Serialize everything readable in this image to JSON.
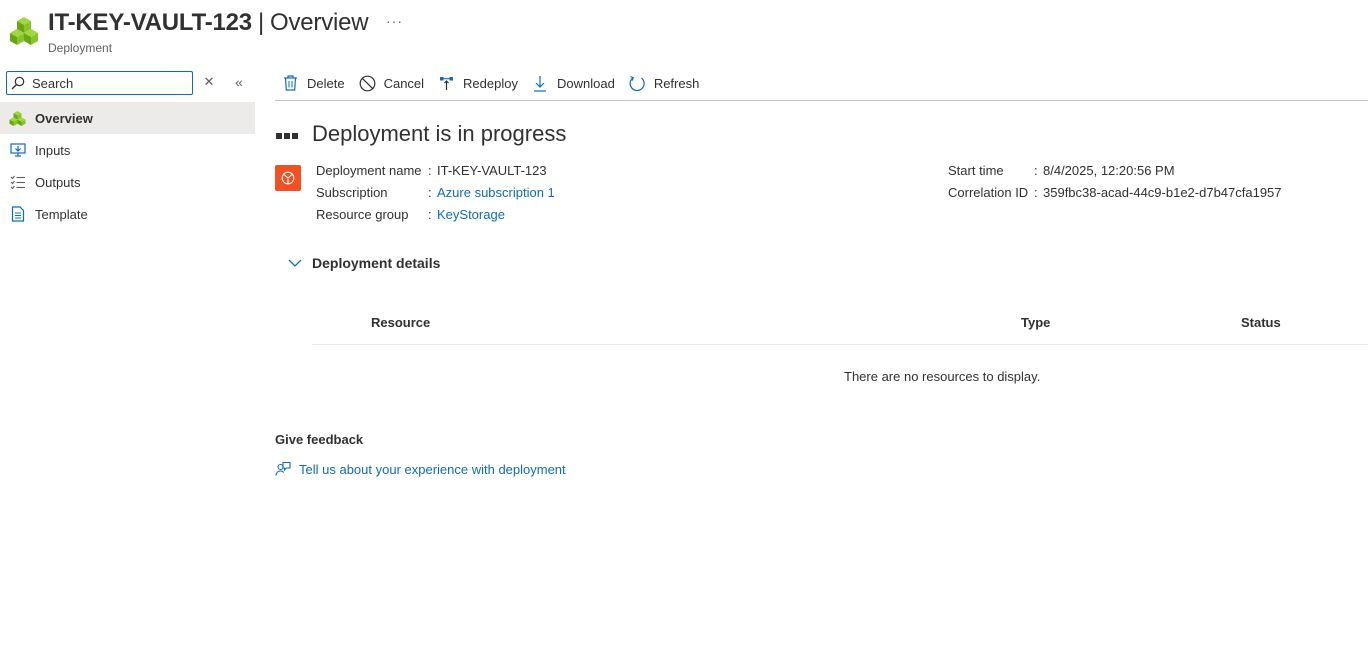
{
  "header": {
    "resource_name": "IT-KEY-VAULT-123",
    "separator": "|",
    "page_name": "Overview",
    "more": "···",
    "subtitle": "Deployment"
  },
  "sidebar": {
    "search_placeholder": "Search",
    "clear_glyph": "✕",
    "collapse_glyph": "«",
    "items": [
      {
        "label": "Overview",
        "icon": "deployment-cubes-icon",
        "active": true
      },
      {
        "label": "Inputs",
        "icon": "inputs-icon",
        "active": false
      },
      {
        "label": "Outputs",
        "icon": "outputs-icon",
        "active": false
      },
      {
        "label": "Template",
        "icon": "template-icon",
        "active": false
      }
    ]
  },
  "toolbar": {
    "delete": "Delete",
    "cancel": "Cancel",
    "redeploy": "Redeploy",
    "download": "Download",
    "refresh": "Refresh"
  },
  "main": {
    "status_title": "Deployment is in progress",
    "properties": {
      "deployment_name_label": "Deployment name",
      "deployment_name": "IT-KEY-VAULT-123",
      "subscription_label": "Subscription",
      "subscription": "Azure subscription 1",
      "resource_group_label": "Resource group",
      "resource_group": "KeyStorage",
      "start_time_label": "Start time",
      "start_time": "8/4/2025, 12:20:56 PM",
      "correlation_id_label": "Correlation ID",
      "correlation_id": "359fbc38-acad-44c9-b1e2-d7b47cfa1957",
      "colon": ":"
    },
    "details_title": "Deployment details",
    "table": {
      "columns": [
        "Resource",
        "Type",
        "Status"
      ],
      "empty_message": "There are no resources to display."
    },
    "feedback_title": "Give feedback",
    "feedback_link": "Tell us about your experience with deployment"
  },
  "colors": {
    "accent": "#0f6cbd",
    "deployment_icon": "#f25022",
    "logo_green": "#7fba00",
    "active_nav_bg": "#edebe9"
  }
}
